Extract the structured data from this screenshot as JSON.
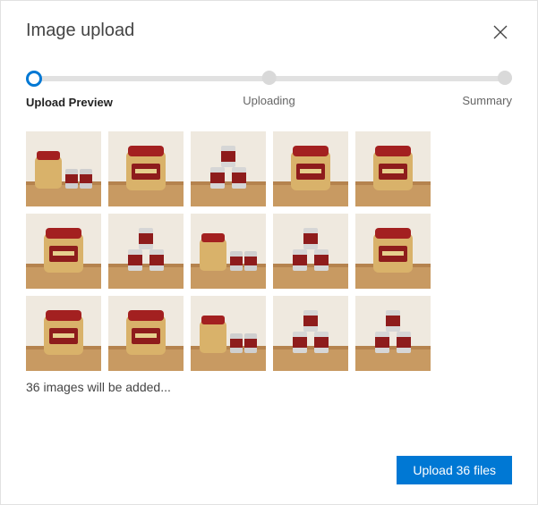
{
  "dialog": {
    "title": "Image upload"
  },
  "stepper": {
    "steps": [
      {
        "label": "Upload Preview",
        "active": true
      },
      {
        "label": "Uploading",
        "active": false
      },
      {
        "label": "Summary",
        "active": false
      }
    ]
  },
  "preview": {
    "caption": "36 images will be added...",
    "thumbnails": [
      {
        "variant": "jar-cans"
      },
      {
        "variant": "cashews"
      },
      {
        "variant": "can-stack"
      },
      {
        "variant": "cashews"
      },
      {
        "variant": "cashews"
      },
      {
        "variant": "cashews"
      },
      {
        "variant": "can-stack"
      },
      {
        "variant": "jar-cans"
      },
      {
        "variant": "can-stack"
      },
      {
        "variant": "cashews"
      },
      {
        "variant": "cashews"
      },
      {
        "variant": "cashews"
      },
      {
        "variant": "jar-cans"
      },
      {
        "variant": "can-stack"
      },
      {
        "variant": "can-stack"
      }
    ]
  },
  "footer": {
    "upload_label": "Upload 36 files"
  }
}
